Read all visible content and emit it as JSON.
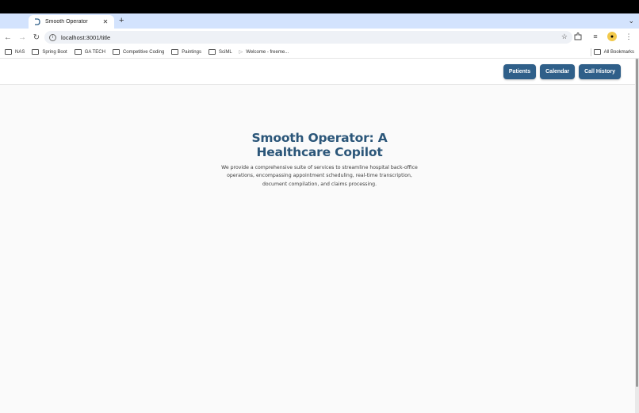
{
  "browser": {
    "tab": {
      "title": "Smooth Operator"
    },
    "url": "localhost:3001/title",
    "bookmarks": [
      {
        "label": "NAS",
        "type": "folder"
      },
      {
        "label": "Spring Boot",
        "type": "folder"
      },
      {
        "label": "GA TECH",
        "type": "folder"
      },
      {
        "label": "Competitive Coding",
        "type": "folder"
      },
      {
        "label": "Paintings",
        "type": "folder"
      },
      {
        "label": "SciML",
        "type": "folder"
      },
      {
        "label": "Welcome - freeme...",
        "type": "page"
      }
    ],
    "all_bookmarks": "All Bookmarks"
  },
  "app": {
    "nav": [
      {
        "label": "Patients"
      },
      {
        "label": "Calendar"
      },
      {
        "label": "Call History"
      }
    ],
    "hero": {
      "title": "Smooth Operator: A Healthcare Copilot",
      "description": "We provide a comprehensive suite of services to streamline hospital back-office operations, encompassing appointment scheduling, real-time transcription, document compilation, and claims processing."
    },
    "colors": {
      "primary": "#2f5f89",
      "title": "#2b5679"
    }
  }
}
